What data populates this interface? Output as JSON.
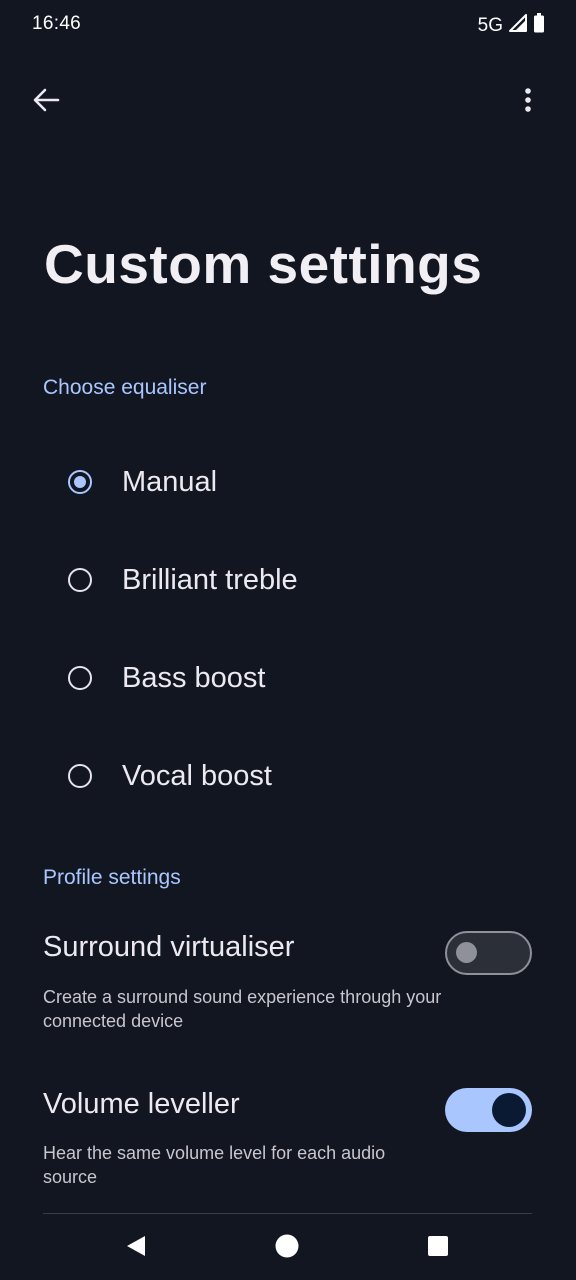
{
  "status_bar": {
    "time": "16:46",
    "network": "5G",
    "signal_icon": "signal-icon",
    "battery_icon": "battery-icon"
  },
  "app_bar": {
    "back_icon": "arrow-back-icon",
    "more_icon": "more-vert-icon"
  },
  "page": {
    "title": "Custom settings"
  },
  "equaliser": {
    "header": "Choose equaliser",
    "selected": "Manual",
    "options": [
      {
        "label": "Manual",
        "checked": true
      },
      {
        "label": "Brilliant treble",
        "checked": false
      },
      {
        "label": "Bass boost",
        "checked": false
      },
      {
        "label": "Vocal boost",
        "checked": false
      }
    ]
  },
  "profile": {
    "header": "Profile settings",
    "settings": [
      {
        "title": "Surround virtualiser",
        "description": "Create a surround sound experience through your connected device",
        "enabled": false
      },
      {
        "title": "Volume leveller",
        "description": "Hear the same volume level for each audio source",
        "enabled": true
      }
    ]
  },
  "nav_bar": {
    "back_icon": "nav-back-icon",
    "home_icon": "nav-home-icon",
    "recents_icon": "nav-recents-icon"
  },
  "colors": {
    "background": "#121620",
    "accent": "#a9c6ff",
    "text_primary": "#eceaf0",
    "text_secondary": "#c7c6cd"
  }
}
